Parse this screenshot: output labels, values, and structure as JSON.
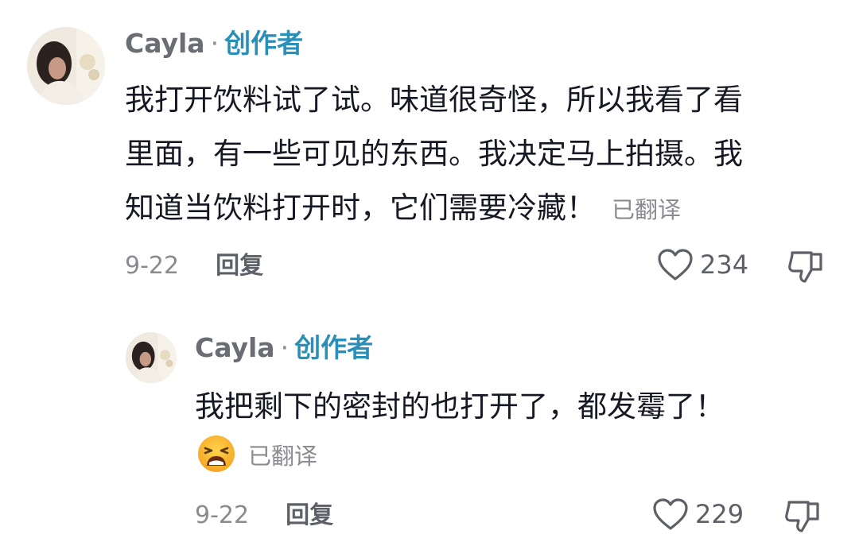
{
  "comments": [
    {
      "username": "Cayla",
      "separator": "·",
      "badge": "创作者",
      "lines": [
        "我打开饮料试了试。味道很奇怪，所以我看了看",
        "里面，有一些可见的东西。我决定马上拍摄。我",
        "知道当饮料打开时，它们需要冷藏！"
      ],
      "translated_label": "已翻译",
      "date": "9-22",
      "reply_label": "回复",
      "likes": "234",
      "icons": {
        "like": "heart-outline-icon",
        "dislike": "thumbs-down-outline-icon"
      }
    },
    {
      "username": "Cayla",
      "separator": "·",
      "badge": "创作者",
      "lines": [
        "我把剩下的密封的也打开了，都发霉了！"
      ],
      "emoji": "weary-face-emoji",
      "translated_label": "已翻译",
      "date": "9-22",
      "reply_label": "回复",
      "likes": "229",
      "icons": {
        "like": "heart-outline-icon",
        "dislike": "thumbs-down-outline-icon"
      }
    }
  ],
  "colors": {
    "creator_badge": "#2a8fb8",
    "text": "#161823",
    "secondary": "#8a8b91"
  }
}
